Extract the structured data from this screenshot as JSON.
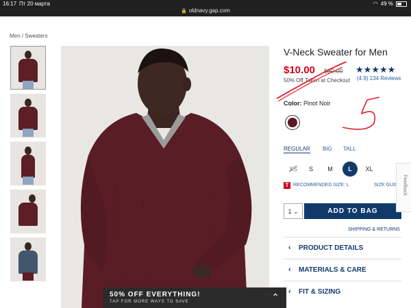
{
  "statusbar": {
    "time": "16:17",
    "date": "Пт 20 марта",
    "battery": "49 %"
  },
  "browser": {
    "url": "oldnavy.gap.com"
  },
  "breadcrumb": "Men / Sweaters",
  "product": {
    "title": "V-Neck Sweater for Men",
    "price": "$10.00",
    "old_price": "$30.00",
    "discount_note": "50% Off Taken at Checkout",
    "stars": "★★★★★",
    "rating": "(4.9) 134 Reviews",
    "color_label": "Color:",
    "color_value": "Pinot Noir",
    "swatch_color": "#5b1a24"
  },
  "fits": [
    "REGULAR",
    "BIG",
    "TALL"
  ],
  "sizes": [
    "XS",
    "S",
    "M",
    "L",
    "XL"
  ],
  "selected_size": "L",
  "recommend": {
    "icon": "T",
    "text": "RECOMMENDED SIZE: L",
    "size_guide": "SIZE GUID"
  },
  "quantity": "1",
  "add_to_bag": "ADD TO BAG",
  "shipping": "SHIPPING & RETURNS",
  "accordions": [
    "PRODUCT DETAILS",
    "MATERIALS & CARE",
    "FIT & SIZING"
  ],
  "promo": {
    "title": "50% OFF EVERYTHING!",
    "subtitle": "TAP FOR MORE WAYS TO SAVE"
  },
  "feedback": "Feedback",
  "handwriting": "5",
  "colors": {
    "brand_navy": "#113a6b",
    "sale_red": "#d0021b",
    "ink": "#e0202a"
  }
}
